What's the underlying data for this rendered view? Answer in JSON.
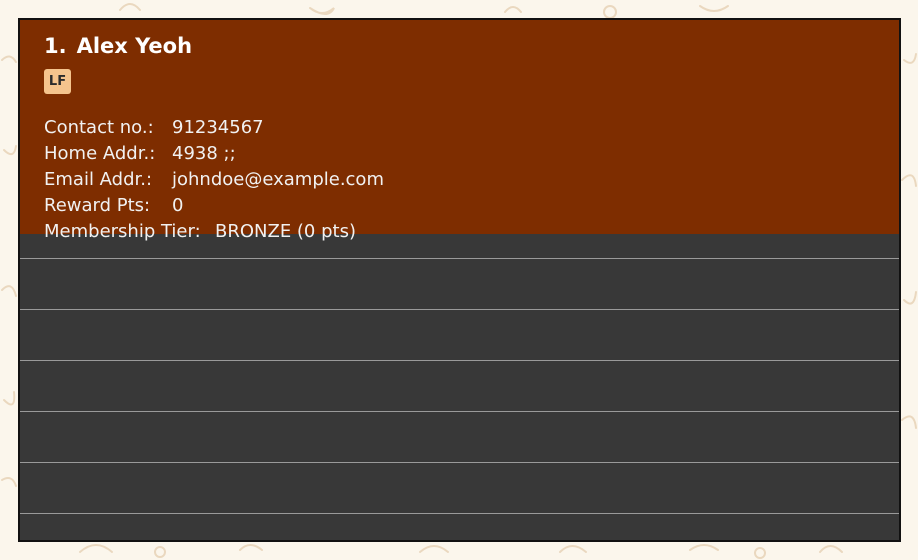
{
  "person_card": {
    "index": "1.",
    "name": "Alex Yeoh",
    "tag": "LF",
    "fields": [
      {
        "label": "Contact no.:",
        "value": "91234567"
      },
      {
        "label": "Home Addr.:",
        "value": "4938 ;;"
      },
      {
        "label": "Email Addr.:",
        "value": "johndoe@example.com"
      },
      {
        "label": "Reward Pts:",
        "value": "0"
      },
      {
        "label": "Membership Tier:",
        "value": "BRONZE (0 pts)"
      }
    ]
  },
  "colors": {
    "card_background": "#7e2d00",
    "list_background": "#383838",
    "tag_background": "#f5c48d",
    "page_background": "#fbf6ec"
  }
}
